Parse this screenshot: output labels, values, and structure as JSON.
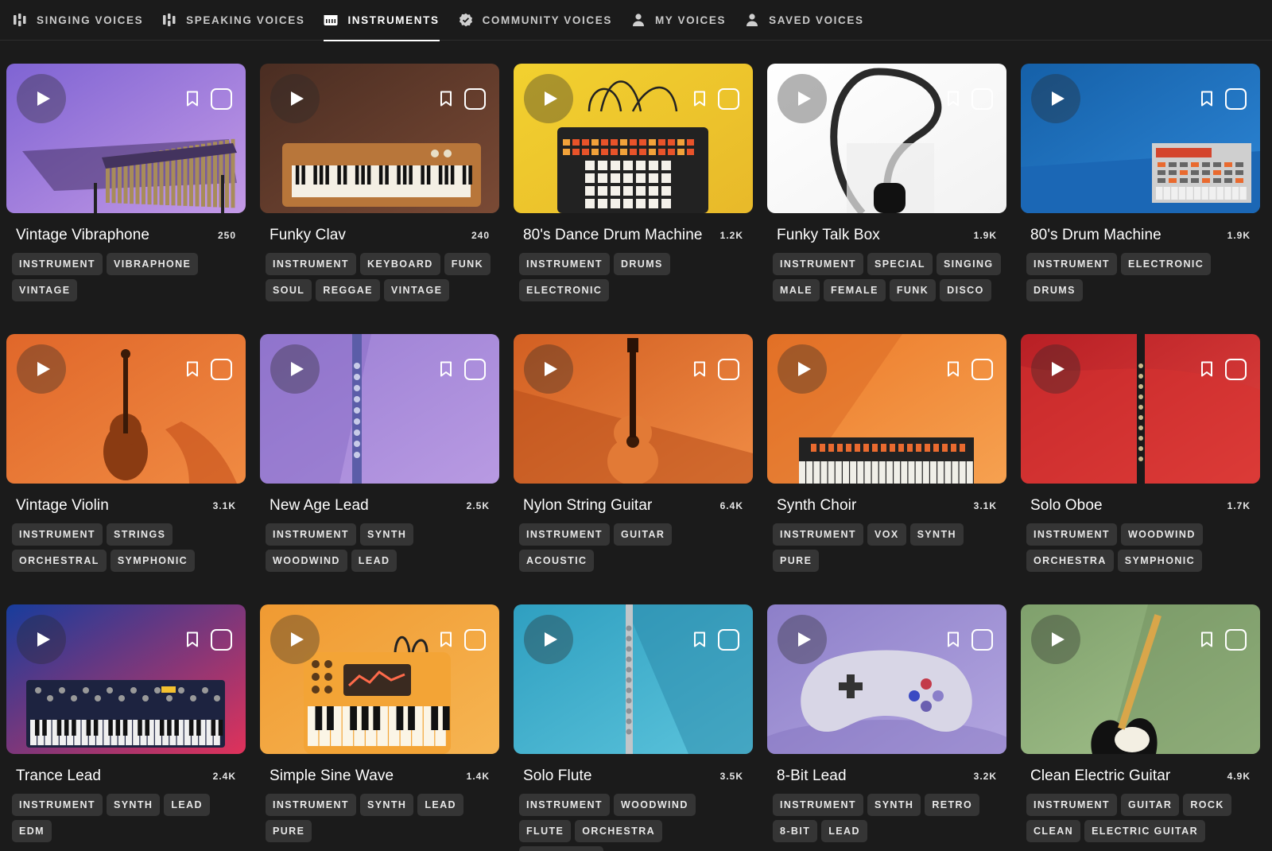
{
  "nav": {
    "tabs": [
      {
        "label": "SINGING VOICES",
        "icon": "voice-wave-icon",
        "active": false
      },
      {
        "label": "SPEAKING VOICES",
        "icon": "voice-wave-icon",
        "active": false
      },
      {
        "label": "INSTRUMENTS",
        "icon": "piano-icon",
        "active": true
      },
      {
        "label": "COMMUNITY VOICES",
        "icon": "verified-badge-icon",
        "active": false
      },
      {
        "label": "MY VOICES",
        "icon": "user-icon",
        "active": false
      },
      {
        "label": "SAVED VOICES",
        "icon": "user-icon",
        "active": false
      }
    ]
  },
  "cards": [
    {
      "title": "Vintage Vibraphone",
      "count": "250",
      "tags": [
        "INSTRUMENT",
        "VIBRAPHONE",
        "VINTAGE"
      ],
      "art": "vibraphone",
      "colors": [
        "#7f64d3",
        "#c49ae6"
      ]
    },
    {
      "title": "Funky Clav",
      "count": "240",
      "tags": [
        "INSTRUMENT",
        "KEYBOARD",
        "FUNK",
        "SOUL",
        "REGGAE",
        "VINTAGE"
      ],
      "art": "clav",
      "colors": [
        "#4a2d22",
        "#7a4a35"
      ]
    },
    {
      "title": "80's Dance Drum Machine",
      "count": "1.2K",
      "tags": [
        "INSTRUMENT",
        "DRUMS",
        "ELECTRONIC"
      ],
      "art": "drum-machine",
      "colors": [
        "#f2d12f",
        "#e8b92a"
      ]
    },
    {
      "title": "Funky Talk Box",
      "count": "1.9K",
      "tags": [
        "INSTRUMENT",
        "SPECIAL",
        "SINGING",
        "MALE",
        "FEMALE",
        "FUNK",
        "DISCO"
      ],
      "art": "talkbox",
      "colors": [
        "#ffffff",
        "#f2f2f2"
      ]
    },
    {
      "title": "80's Drum Machine",
      "count": "1.9K",
      "tags": [
        "INSTRUMENT",
        "ELECTRONIC",
        "DRUMS"
      ],
      "art": "mpc",
      "colors": [
        "#1560a8",
        "#2d86d6"
      ]
    },
    {
      "title": "Vintage Violin",
      "count": "3.1K",
      "tags": [
        "INSTRUMENT",
        "STRINGS",
        "ORCHESTRAL",
        "SYMPHONIC"
      ],
      "art": "violin",
      "colors": [
        "#e0672a",
        "#f08a42"
      ]
    },
    {
      "title": "New Age Lead",
      "count": "2.5K",
      "tags": [
        "INSTRUMENT",
        "SYNTH",
        "WOODWIND",
        "LEAD"
      ],
      "art": "flute-purple",
      "colors": [
        "#9b7fd4",
        "#b89ae2"
      ]
    },
    {
      "title": "Nylon String Guitar",
      "count": "6.4K",
      "tags": [
        "INSTRUMENT",
        "GUITAR",
        "ACOUSTIC"
      ],
      "art": "guitar",
      "colors": [
        "#d25f22",
        "#f08c45"
      ]
    },
    {
      "title": "Synth Choir",
      "count": "3.1K",
      "tags": [
        "INSTRUMENT",
        "VOX",
        "SYNTH",
        "PURE"
      ],
      "art": "synth-keys",
      "colors": [
        "#ec7a2a",
        "#f6a150"
      ]
    },
    {
      "title": "Solo Oboe",
      "count": "1.7K",
      "tags": [
        "INSTRUMENT",
        "WOODWIND",
        "ORCHESTRA",
        "SYMPHONIC"
      ],
      "art": "oboe",
      "colors": [
        "#b81f25",
        "#e0443f"
      ]
    },
    {
      "title": "Trance Lead",
      "count": "2.4K",
      "tags": [
        "INSTRUMENT",
        "SYNTH",
        "LEAD",
        "EDM"
      ],
      "art": "moog",
      "colors": [
        "#173c9c",
        "#e0325a"
      ]
    },
    {
      "title": "Simple Sine Wave",
      "count": "1.4K",
      "tags": [
        "INSTRUMENT",
        "SYNTH",
        "LEAD",
        "PURE"
      ],
      "art": "orange-synth",
      "colors": [
        "#f09a32",
        "#f6b552"
      ]
    },
    {
      "title": "Solo Flute",
      "count": "3.5K",
      "tags": [
        "INSTRUMENT",
        "WOODWIND",
        "FLUTE",
        "ORCHESTRA",
        "SYMPHONIC"
      ],
      "art": "flute-blue",
      "colors": [
        "#2f9fc0",
        "#5cc4dc"
      ]
    },
    {
      "title": "8-Bit Lead",
      "count": "3.2K",
      "tags": [
        "INSTRUMENT",
        "SYNTH",
        "RETRO",
        "8-BIT",
        "LEAD"
      ],
      "art": "gamepad",
      "colors": [
        "#8d7fc9",
        "#b3a6e0"
      ]
    },
    {
      "title": "Clean Electric Guitar",
      "count": "4.9K",
      "tags": [
        "INSTRUMENT",
        "GUITAR",
        "ROCK",
        "CLEAN",
        "ELECTRIC GUITAR"
      ],
      "art": "electric-guitar",
      "colors": [
        "#7fa06c",
        "#a6c48e"
      ]
    }
  ]
}
